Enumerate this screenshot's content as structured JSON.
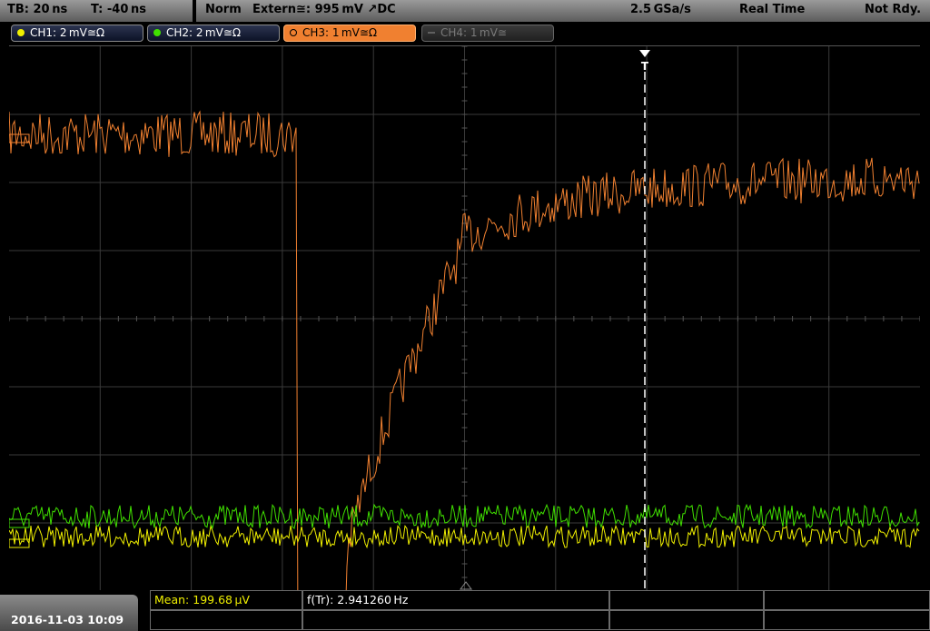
{
  "topbar": {
    "timebase": "TB: 20 ns",
    "trigger_time": "T: -40 ns",
    "mode": "Norm",
    "trigger_source": "Extern≅: 995 mV ↗DC",
    "sample_rate": "2.5 GSa/s",
    "acq_mode": "Real Time",
    "status": "Not Rdy."
  },
  "channels": [
    {
      "label": "CH1: 2 mV≅Ω",
      "color": "#f0f000",
      "state": "on"
    },
    {
      "label": "CH2: 2 mV≅Ω",
      "color": "#40e000",
      "state": "on"
    },
    {
      "label": "CH3: 1 mV≅Ω",
      "color": "#f08030",
      "state": "active"
    },
    {
      "label": "CH4: 1 mV≅",
      "color": "#606060",
      "state": "off"
    }
  ],
  "trigger_marker": "T",
  "measurements": {
    "mean": "Mean: 199.68 μV",
    "frequency": "f(Tr): 2.941260 Hz"
  },
  "datetime": "2016-11-03 10:09",
  "colors": {
    "ch1": "#f0f000",
    "ch2": "#40e000",
    "ch3": "#f08030",
    "grid": "#3a3a3a",
    "mean_text": "#f0f000"
  }
}
